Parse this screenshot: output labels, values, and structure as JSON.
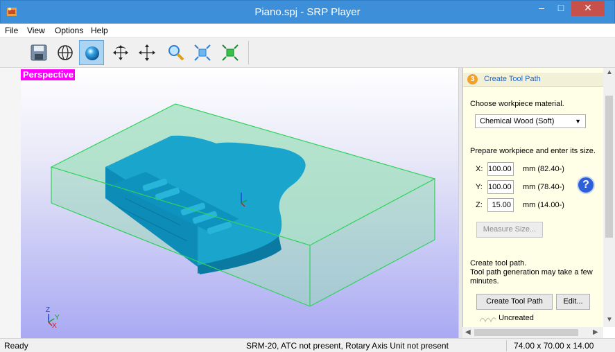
{
  "window": {
    "title": "Piano.spj - SRP Player",
    "close_glyph": "✕",
    "minimize_glyph": "–",
    "maximize_glyph": "□"
  },
  "menu": [
    "File",
    "View",
    "Options",
    "Help"
  ],
  "toolbar": {
    "tools": [
      "save-icon",
      "globe-wireframe-icon",
      "shaded-sphere-icon",
      "rotate-icon",
      "pan-icon",
      "zoom-icon",
      "fit-view-icon",
      "reset-view-icon"
    ],
    "active_tool": "shaded-sphere-icon"
  },
  "viewport": {
    "view_mode": "Perspective",
    "axis_labels": {
      "z": "Z",
      "y": "Y",
      "x": "X"
    },
    "colors": {
      "model": "#1aa6cc",
      "workpiece_edge": "#2fd25a",
      "label_bg": "#ff00ff"
    }
  },
  "panel": {
    "step_number": "3",
    "title": "Create Tool Path",
    "material_prompt": "Choose workpiece material.",
    "material_value": "Chemical Wood (Soft)",
    "size_prompt": "Prepare workpiece and enter its size.",
    "dims": [
      {
        "axis": "X:",
        "value": "100.00",
        "unit": "mm  (82.40-)"
      },
      {
        "axis": "Y:",
        "value": "100.00",
        "unit": "mm  (78.40-)"
      },
      {
        "axis": "Z:",
        "value": "15.00",
        "unit": "mm  (14.00-)"
      }
    ],
    "help_label": "?",
    "measure_button": "Measure Size...",
    "create_prompt": "Create tool path.",
    "create_note": "Tool path generation may take a few minutes.",
    "create_button": "Create Tool Path",
    "edit_button": "Edit...",
    "path_status": "Uncreated"
  },
  "statusbar": {
    "state": "Ready",
    "machine": "SRM-20, ATC not present, Rotary Axis Unit not present",
    "size": "74.00 x 70.00 x 14.00"
  }
}
